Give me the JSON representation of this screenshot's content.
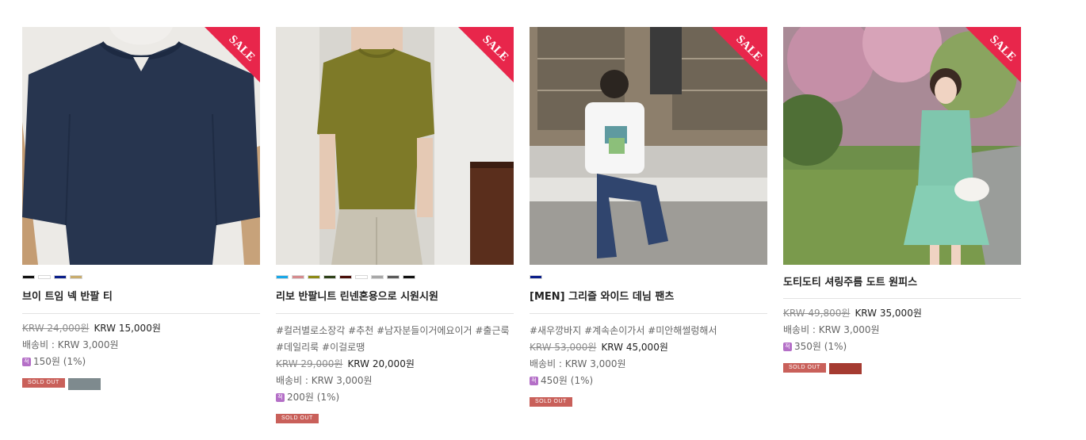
{
  "sale_label": "SALE",
  "badge_text": "SOLD OUT",
  "colors": {
    "sale_red": "#e8264b",
    "soldout": "#c9605a"
  },
  "products": [
    {
      "name": "브이 트임 넥 반팔 티",
      "swatches": [
        "#111111",
        "#ffffff",
        "#0b1f8a",
        "#c9ad6e"
      ],
      "tags": "",
      "old_price": "KRW 24,000원",
      "new_price": "KRW 15,000원",
      "shipping": "배송비 : KRW 3,000원",
      "points": "150원 (1%)",
      "extra_badge_color": "#7e8a8e"
    },
    {
      "name": "리보 반팔니트 린넨혼용으로 시원시원",
      "swatches": [
        "#1aa8e8",
        "#d68b8e",
        "#8e8a16",
        "#2f4219",
        "#4a0f09",
        "#ffffff",
        "#a8a8a8",
        "#5a5a5a",
        "#111111"
      ],
      "tags": "#컬러별로소장각 #추천 #남자분들이거에요이거 #출근룩 #데일리룩 #이걸로땡",
      "old_price": "KRW 29,000원",
      "new_price": "KRW 20,000원",
      "shipping": "배송비 : KRW 3,000원",
      "points": "200원 (1%)",
      "extra_badge_color": ""
    },
    {
      "name": "[MEN] 그리즐 와이드 데님 팬츠",
      "swatches": [
        "#0b1f8a"
      ],
      "tags": "#새우깡바지 #계속손이가서 #미안해썰렁해서",
      "old_price": "KRW 53,000원",
      "new_price": "KRW 45,000원",
      "shipping": "배송비 : KRW 3,000원",
      "points": "450원 (1%)",
      "extra_badge_color": ""
    },
    {
      "name": "도티도티 셔링주름 도트 원피스",
      "swatches": [],
      "tags": "",
      "old_price": "KRW 49,800원",
      "new_price": "KRW 35,000원",
      "shipping": "배송비 : KRW 3,000원",
      "points": "350원 (1%)",
      "extra_badge_color": "#a53b31"
    }
  ]
}
